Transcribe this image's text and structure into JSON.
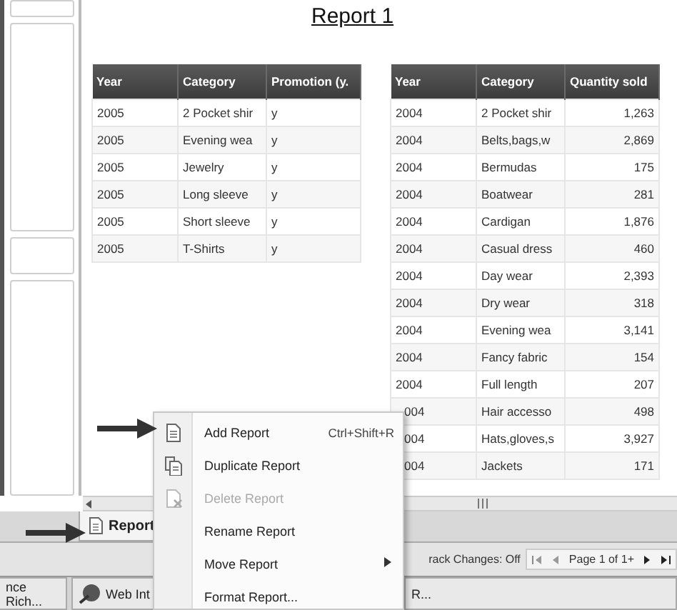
{
  "report_title": "Report 1",
  "tables": [
    {
      "columns": [
        "Year",
        "Category",
        "Promotion (y."
      ],
      "rows": [
        [
          "2005",
          "2 Pocket shir",
          "y"
        ],
        [
          "2005",
          "Evening wea",
          "y"
        ],
        [
          "2005",
          "Jewelry",
          "y"
        ],
        [
          "2005",
          "Long sleeve",
          "y"
        ],
        [
          "2005",
          "Short sleeve",
          "y"
        ],
        [
          "2005",
          "T-Shirts",
          "y"
        ]
      ]
    },
    {
      "columns": [
        "Year",
        "Category",
        "Quantity sold"
      ],
      "rows": [
        [
          "2004",
          "2 Pocket shir",
          "1,263"
        ],
        [
          "2004",
          "Belts,bags,w",
          "2,869"
        ],
        [
          "2004",
          "Bermudas",
          "175"
        ],
        [
          "2004",
          "Boatwear",
          "281"
        ],
        [
          "2004",
          "Cardigan",
          "1,876"
        ],
        [
          "2004",
          "Casual dress",
          "460"
        ],
        [
          "2004",
          "Day wear",
          "2,393"
        ],
        [
          "2004",
          "Dry wear",
          "318"
        ],
        [
          "2004",
          "Evening wea",
          "3,141"
        ],
        [
          "2004",
          "Fancy fabric",
          "154"
        ],
        [
          "2004",
          "Full length",
          "207"
        ],
        [
          "004",
          "Hair accesso",
          "498"
        ],
        [
          "004",
          "Hats,gloves,s",
          "3,927"
        ],
        [
          "004",
          "Jackets",
          "171"
        ]
      ]
    }
  ],
  "report_tab": {
    "label": "Report",
    "selected": true
  },
  "status": {
    "track_changes": "rack Changes: Off",
    "page": "Page 1 of 1+"
  },
  "taskbar": [
    {
      "label": "nce Rich...",
      "kind": "plain"
    },
    {
      "label": "Web Int",
      "kind": "icon"
    },
    {
      "label": "R...",
      "kind": "plain"
    }
  ],
  "context_menu": [
    {
      "label": "Add Report",
      "shortcut": "Ctrl+Shift+R",
      "disabled": false,
      "submenu": false
    },
    {
      "label": "Duplicate Report",
      "disabled": false,
      "submenu": false
    },
    {
      "label": "Delete Report",
      "disabled": true,
      "submenu": false
    },
    {
      "label": "Rename Report",
      "disabled": false,
      "submenu": false
    },
    {
      "label": "Move Report",
      "disabled": false,
      "submenu": true
    },
    {
      "label": "Format Report...",
      "disabled": false,
      "submenu": false
    }
  ]
}
